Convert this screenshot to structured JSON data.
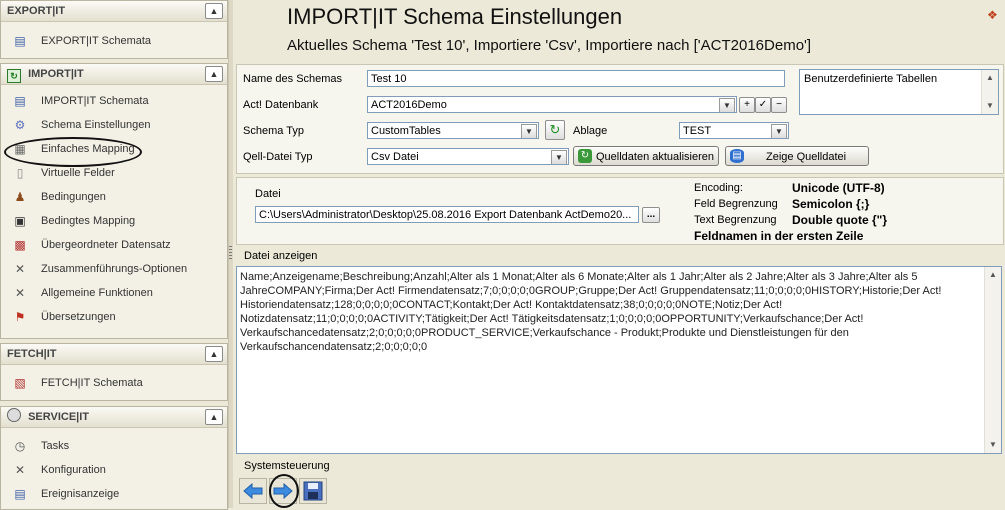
{
  "sidebar": {
    "export": {
      "title": "EXPORT|IT",
      "items": [
        {
          "label": "EXPORT|IT Schemata",
          "icon": "schema-list-icon"
        }
      ]
    },
    "import": {
      "title": "IMPORT|IT",
      "items": [
        {
          "label": "IMPORT|IT Schemata",
          "icon": "schema-list-icon"
        },
        {
          "label": "Schema Einstellungen",
          "icon": "gears-icon"
        },
        {
          "label": "Einfaches Mapping",
          "icon": "mapping-icon"
        },
        {
          "label": "Virtuelle Felder",
          "icon": "virtual-field-icon"
        },
        {
          "label": "Bedingungen",
          "icon": "person-icon"
        },
        {
          "label": "Bedingtes Mapping",
          "icon": "briefcase-icon"
        },
        {
          "label": "Übergeordneter Datensatz",
          "icon": "books-icon"
        },
        {
          "label": "Zusammenführungs-Optionen",
          "icon": "tools-icon"
        },
        {
          "label": "Allgemeine Funktionen",
          "icon": "tools-icon"
        },
        {
          "label": "Übersetzungen",
          "icon": "flags-icon"
        }
      ]
    },
    "fetch": {
      "title": "FETCH|IT",
      "items": [
        {
          "label": "FETCH|IT Schemata",
          "icon": "chart-icon"
        }
      ]
    },
    "service": {
      "title": "SERVICE|IT",
      "items": [
        {
          "label": "Tasks",
          "icon": "clock-icon"
        },
        {
          "label": "Konfiguration",
          "icon": "tools-icon"
        },
        {
          "label": "Ereignisanzeige",
          "icon": "log-icon"
        }
      ]
    }
  },
  "main": {
    "title": "IMPORT|IT Schema Einstellungen",
    "subtitle": "Aktuelles Schema 'Test 10', Importiere 'Csv', Importiere nach ['ACT2016Demo']",
    "form": {
      "schema_name_label": "Name des Schemas",
      "schema_name_value": "Test 10",
      "database_label": "Act! Datenbank",
      "database_value": "ACT2016Demo",
      "schema_type_label": "Schema Typ",
      "schema_type_value": "CustomTables",
      "ablage_label": "Ablage",
      "ablage_value": "TEST",
      "source_type_label": "Qell-Datei Typ",
      "source_type_value": "Csv Datei",
      "refresh_button": "Quelldaten aktualisieren",
      "show_source_button": "Zeige Quelldatei",
      "custom_tables_label": "Benutzerdefinierte Tabellen"
    },
    "file": {
      "label": "Datei",
      "path": "C:\\Users\\Administrator\\Desktop\\25.08.2016 Export Datenbank ActDemo20...",
      "browse_button": "...",
      "encoding_label": "Encoding:",
      "encoding_value": "Unicode (UTF-8)",
      "field_delim_label": "Feld Begrenzung",
      "field_delim_value": "Semicolon {;}",
      "text_delim_label": "Text Begrenzung",
      "text_delim_value": "Double quote {\"}",
      "header_note": "Feldnamen in der ersten Zeile"
    },
    "preview": {
      "label": "Datei anzeigen",
      "content": "Name;Anzeigename;Beschreibung;Anzahl;Alter als 1 Monat;Alter als 6 Monate;Alter als 1 Jahr;Alter als 2 Jahre;Alter als 3 Jahre;Alter als 5 JahreCOMPANY;Firma;Der Act! Firmendatensatz;7;0;0;0;0;0GROUP;Gruppe;Der Act! Gruppendatensatz;11;0;0;0;0;0HISTORY;Historie;Der Act! Historiendatensatz;128;0;0;0;0;0CONTACT;Kontakt;Der Act! Kontaktdatensatz;38;0;0;0;0;0NOTE;Notiz;Der Act! Notizdatensatz;11;0;0;0;0;0ACTIVITY;Tätigkeit;Der Act! Tätigkeitsdatensatz;1;0;0;0;0;0OPPORTUNITY;Verkaufschance;Der Act! Verkaufschancedatensatz;2;0;0;0;0;0PRODUCT_SERVICE;Verkaufschance - Produkt;Produkte und Dienstleistungen für den Verkaufschancendatensatz;2;0;0;0;0;0"
    },
    "system": {
      "label": "Systemsteuerung"
    }
  }
}
